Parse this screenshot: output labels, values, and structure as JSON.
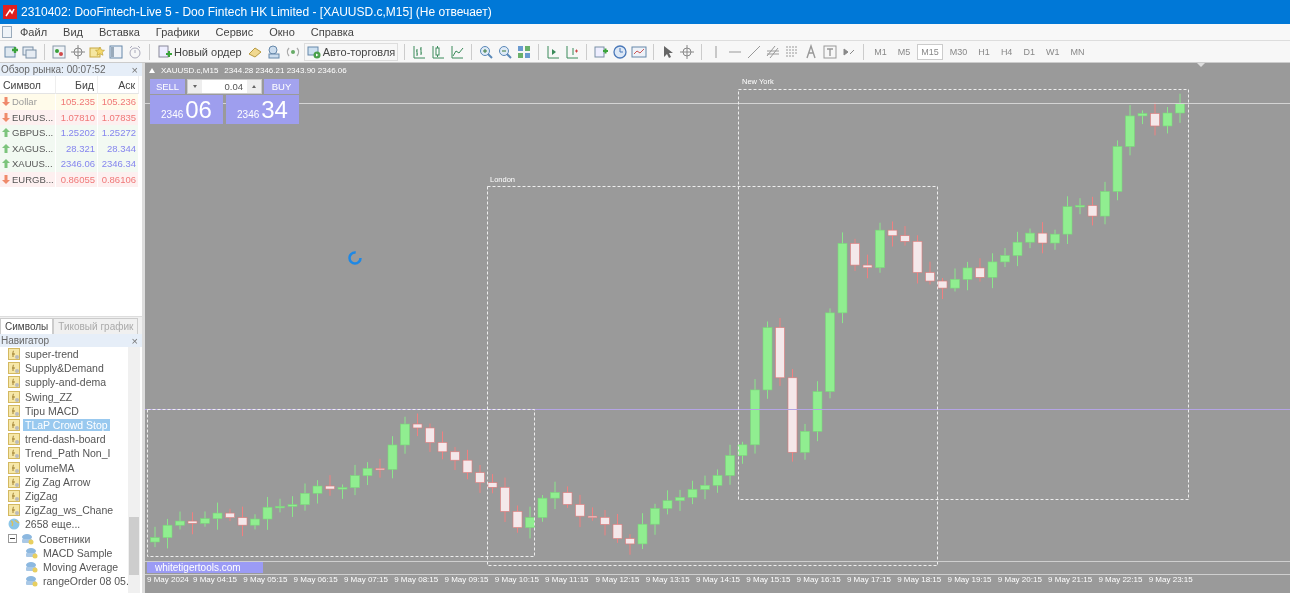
{
  "window": {
    "title": "2310402: DooFintech-Live 5 - Doo Fintech HK Limited - [XAUUSD.c,M15] (Не отвечает)"
  },
  "menu": [
    "Файл",
    "Вид",
    "Вставка",
    "Графики",
    "Сервис",
    "Окно",
    "Справка"
  ],
  "toolbar": {
    "new_order": "Новый ордер",
    "auto_trading": "Авто-торговля",
    "timeframes": [
      {
        "label": "M1",
        "selected": false
      },
      {
        "label": "M5",
        "selected": false
      },
      {
        "label": "M15",
        "selected": true
      },
      {
        "label": "M30",
        "selected": false
      },
      {
        "label": "H1",
        "selected": false
      },
      {
        "label": "H4",
        "selected": false
      },
      {
        "label": "D1",
        "selected": false
      },
      {
        "label": "W1",
        "selected": false
      },
      {
        "label": "MN",
        "selected": false
      }
    ]
  },
  "market_watch": {
    "title": "Обзор рынка: 00:07:52",
    "close": "×",
    "columns": [
      "Символ",
      "Бид",
      "Аск"
    ],
    "rows": [
      {
        "symbol": "Dollar",
        "bid": "105.235",
        "ask": "105.236",
        "rising": false,
        "muted": true
      },
      {
        "symbol": "EURUS...",
        "bid": "1.07810",
        "ask": "1.07835",
        "rising": false,
        "muted": false
      },
      {
        "symbol": "GBPUS...",
        "bid": "1.25202",
        "ask": "1.25272",
        "rising": true,
        "muted": false
      },
      {
        "symbol": "XAGUS...",
        "bid": "28.321",
        "ask": "28.344",
        "rising": true,
        "muted": false
      },
      {
        "symbol": "XAUUS...",
        "bid": "2346.06",
        "ask": "2346.34",
        "rising": true,
        "muted": false
      },
      {
        "symbol": "EURGB...",
        "bid": "0.86055",
        "ask": "0.86106",
        "rising": false,
        "muted": false
      }
    ]
  },
  "panel_tabs": [
    {
      "label": "Символы",
      "selected": true
    },
    {
      "label": "Тиковый график",
      "selected": false
    }
  ],
  "navigator": {
    "title": "Навигатор",
    "close": "×",
    "tree": [
      {
        "children": [
          {
            "label": "super-trend",
            "kind": "indicator",
            "selected": false
          },
          {
            "label": "Supply&Demand",
            "kind": "indicator",
            "selected": false
          },
          {
            "label": "supply-and-dema",
            "kind": "indicator",
            "selected": false
          },
          {
            "label": "Swing_ZZ",
            "kind": "indicator",
            "selected": false
          },
          {
            "label": "Tipu MACD",
            "kind": "indicator",
            "selected": false
          },
          {
            "label": "TLaP Crowd Stop",
            "kind": "indicator",
            "selected": true
          },
          {
            "label": "trend-dash-board",
            "kind": "indicator",
            "selected": false
          },
          {
            "label": "Trend_Path Non_I",
            "kind": "indicator",
            "selected": false
          },
          {
            "label": "volumeMA",
            "kind": "indicator",
            "selected": false
          },
          {
            "label": "Zig Zag Arrow",
            "kind": "indicator",
            "selected": false
          },
          {
            "label": "ZigZag",
            "kind": "indicator",
            "selected": false
          },
          {
            "label": "ZigZag_ws_Chane",
            "kind": "indicator",
            "selected": false
          },
          {
            "label": "2658 еще...",
            "kind": "more",
            "selected": false
          }
        ]
      },
      {
        "label": "Советники",
        "kind": "folder",
        "selected": false,
        "expanded": true,
        "children": [
          {
            "label": "MACD Sample",
            "kind": "expert",
            "selected": false
          },
          {
            "label": "Moving Average",
            "kind": "expert",
            "selected": false
          },
          {
            "label": "rangeOrder 08 05.",
            "kind": "expert",
            "selected": false
          }
        ]
      }
    ]
  },
  "chart": {
    "symbol": "XAUUSD.c,M15",
    "ohlc": "2344.28 2346.21 2343.90 2346.06",
    "trade_panel": {
      "sell": "SELL",
      "buy": "BUY",
      "volume": "0.04",
      "sell_price_main": "2346",
      "sell_price_big": "06",
      "buy_price_main": "2346",
      "buy_price_big": "34"
    },
    "sessions": [
      {
        "name": "London"
      },
      {
        "name": "New York"
      }
    ],
    "label": "whitetigertools.com",
    "time_axis": [
      "9 May 2024",
      "9 May 04:15",
      "9 May 05:15",
      "9 May 06:15",
      "9 May 07:15",
      "9 May 08:15",
      "9 May 09:15",
      "9 May 10:15",
      "9 May 11:15",
      "9 May 12:15",
      "9 May 13:15",
      "9 May 14:15",
      "9 May 15:15",
      "9 May 16:15",
      "9 May 17:15",
      "9 May 18:15",
      "9 May 19:15",
      "9 May 20:15",
      "9 May 21:15",
      "9 May 22:15",
      "9 May 23:15"
    ]
  }
}
